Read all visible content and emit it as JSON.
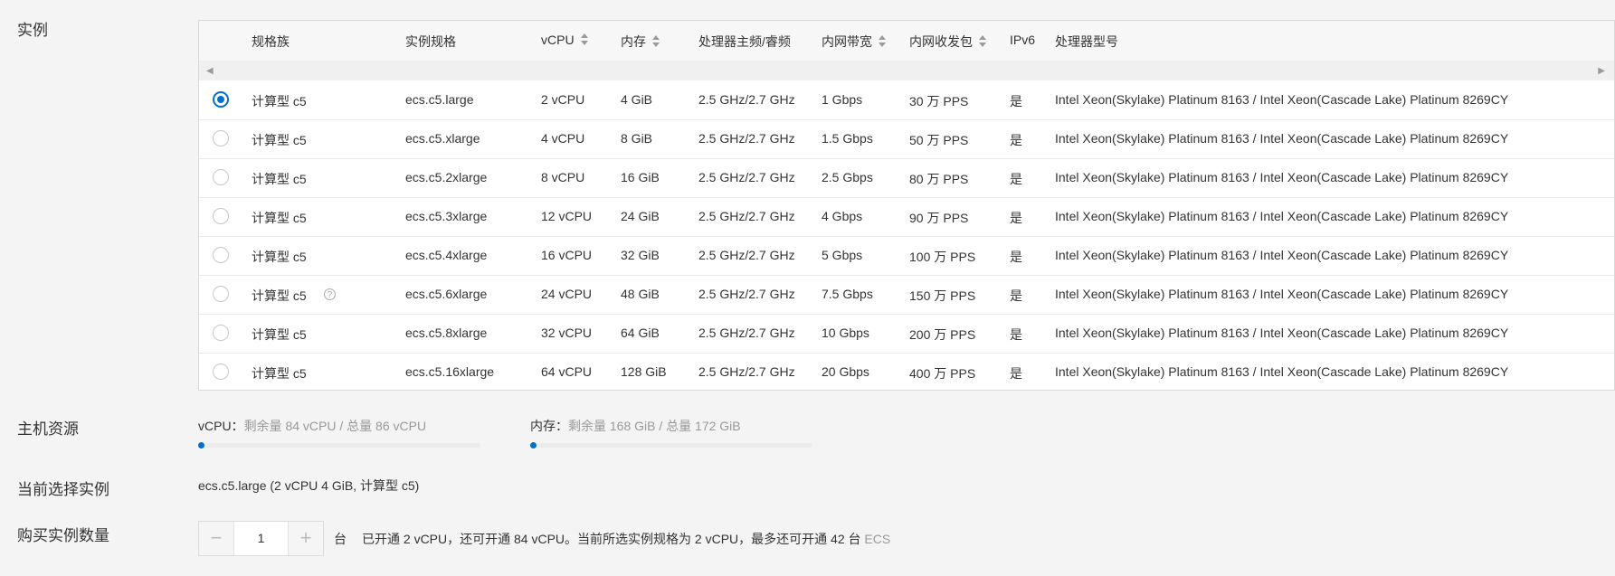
{
  "labels": {
    "instance": "实例",
    "host_resource": "主机资源",
    "current_selection": "当前选择实例",
    "purchase_quantity": "购买实例数量"
  },
  "table": {
    "headers": {
      "family": "规格族",
      "spec": "实例规格",
      "vcpu": "vCPU",
      "memory": "内存",
      "freq": "处理器主频/睿频",
      "bandwidth": "内网带宽",
      "pps": "内网收发包",
      "ipv6": "IPv6",
      "cpu_model": "处理器型号"
    },
    "rows": [
      {
        "family": "计算型 c5",
        "spec": "ecs.c5.large",
        "vcpu": "2 vCPU",
        "memory": "4 GiB",
        "freq": "2.5 GHz/2.7 GHz",
        "bandwidth": "1 Gbps",
        "pps": "30 万 PPS",
        "ipv6": "是",
        "cpu_model": "Intel Xeon(Skylake) Platinum 8163 / Intel Xeon(Cascade Lake) Platinum 8269CY",
        "selected": true
      },
      {
        "family": "计算型 c5",
        "spec": "ecs.c5.xlarge",
        "vcpu": "4 vCPU",
        "memory": "8 GiB",
        "freq": "2.5 GHz/2.7 GHz",
        "bandwidth": "1.5 Gbps",
        "pps": "50 万 PPS",
        "ipv6": "是",
        "cpu_model": "Intel Xeon(Skylake) Platinum 8163 / Intel Xeon(Cascade Lake) Platinum 8269CY",
        "selected": false
      },
      {
        "family": "计算型 c5",
        "spec": "ecs.c5.2xlarge",
        "vcpu": "8 vCPU",
        "memory": "16 GiB",
        "freq": "2.5 GHz/2.7 GHz",
        "bandwidth": "2.5 Gbps",
        "pps": "80 万 PPS",
        "ipv6": "是",
        "cpu_model": "Intel Xeon(Skylake) Platinum 8163 / Intel Xeon(Cascade Lake) Platinum 8269CY",
        "selected": false
      },
      {
        "family": "计算型 c5",
        "spec": "ecs.c5.3xlarge",
        "vcpu": "12 vCPU",
        "memory": "24 GiB",
        "freq": "2.5 GHz/2.7 GHz",
        "bandwidth": "4 Gbps",
        "pps": "90 万 PPS",
        "ipv6": "是",
        "cpu_model": "Intel Xeon(Skylake) Platinum 8163 / Intel Xeon(Cascade Lake) Platinum 8269CY",
        "selected": false
      },
      {
        "family": "计算型 c5",
        "spec": "ecs.c5.4xlarge",
        "vcpu": "16 vCPU",
        "memory": "32 GiB",
        "freq": "2.5 GHz/2.7 GHz",
        "bandwidth": "5 Gbps",
        "pps": "100 万 PPS",
        "ipv6": "是",
        "cpu_model": "Intel Xeon(Skylake) Platinum 8163 / Intel Xeon(Cascade Lake) Platinum 8269CY",
        "selected": false
      },
      {
        "family": "计算型 c5",
        "spec": "ecs.c5.6xlarge",
        "vcpu": "24 vCPU",
        "memory": "48 GiB",
        "freq": "2.5 GHz/2.7 GHz",
        "bandwidth": "7.5 Gbps",
        "pps": "150 万 PPS",
        "ipv6": "是",
        "cpu_model": "Intel Xeon(Skylake) Platinum 8163 / Intel Xeon(Cascade Lake) Platinum 8269CY",
        "selected": false,
        "help_icon": true
      },
      {
        "family": "计算型 c5",
        "spec": "ecs.c5.8xlarge",
        "vcpu": "32 vCPU",
        "memory": "64 GiB",
        "freq": "2.5 GHz/2.7 GHz",
        "bandwidth": "10 Gbps",
        "pps": "200 万 PPS",
        "ipv6": "是",
        "cpu_model": "Intel Xeon(Skylake) Platinum 8163 / Intel Xeon(Cascade Lake) Platinum 8269CY",
        "selected": false
      },
      {
        "family": "计算型 c5",
        "spec": "ecs.c5.16xlarge",
        "vcpu": "64 vCPU",
        "memory": "128 GiB",
        "freq": "2.5 GHz/2.7 GHz",
        "bandwidth": "20 Gbps",
        "pps": "400 万 PPS",
        "ipv6": "是",
        "cpu_model": "Intel Xeon(Skylake) Platinum 8163 / Intel Xeon(Cascade Lake) Platinum 8269CY",
        "selected": false
      }
    ]
  },
  "resources": {
    "vcpu_label": "vCPU：",
    "vcpu_text": "剩余量 84 vCPU / 总量 86 vCPU",
    "vcpu_used_fraction": 0.023,
    "mem_label": "内存：",
    "mem_text": "剩余量 168 GiB / 总量 172 GiB",
    "mem_used_fraction": 0.023
  },
  "current_selection": "ecs.c5.large (2 vCPU 4 GiB, 计算型 c5)",
  "quantity": {
    "value": "1",
    "unit": "台",
    "hint_a": "已开通 2 vCPU，还可开通 84 vCPU。当前所选实例规格为 2 vCPU，最多还可开通 42 台",
    "hint_b": "ECS"
  },
  "colors": {
    "accent": "#0070cc"
  },
  "icons": {
    "minus": "minus-icon",
    "plus": "plus-icon",
    "help": "help-icon",
    "scroll_left": "arrow-left-icon",
    "scroll_right": "arrow-right-icon"
  }
}
